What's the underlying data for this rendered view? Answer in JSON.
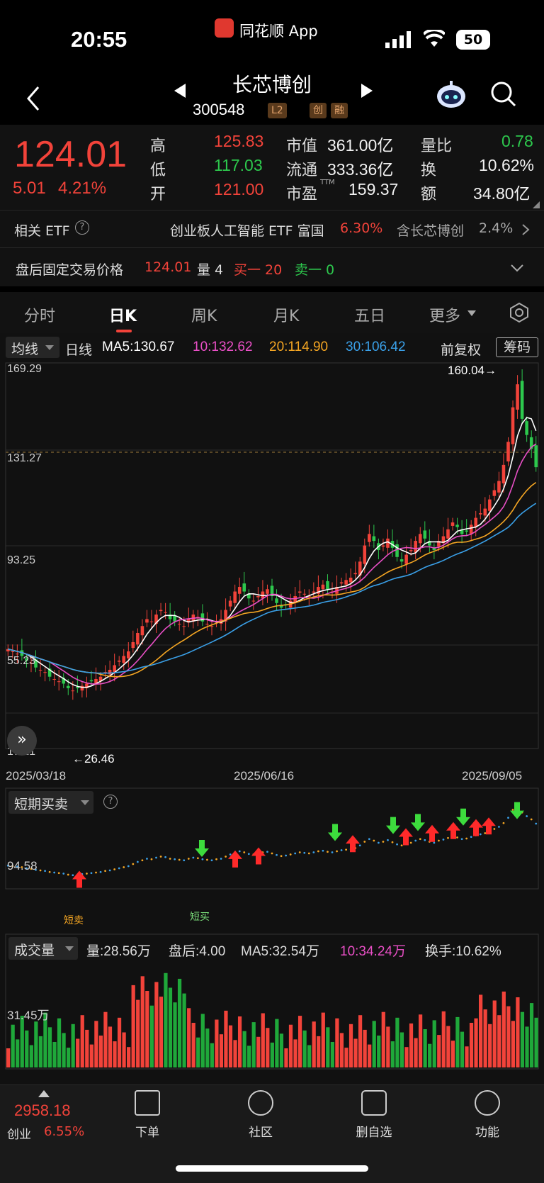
{
  "status_bar": {
    "time": "20:55",
    "app_name": "同花顺 App",
    "battery": "50"
  },
  "nav": {
    "stock_name": "长芯博创",
    "stock_code": "300548",
    "tags": [
      "L2",
      "创",
      "融"
    ]
  },
  "quote": {
    "price": "124.01",
    "change": "5.01",
    "change_pct": "4.21%",
    "high_label": "高",
    "high": "125.83",
    "low_label": "低",
    "low": "117.03",
    "open_label": "开",
    "open": "121.00",
    "mktcap_label": "市值",
    "mktcap": "361.00亿",
    "float_label": "流通",
    "float_cap": "333.36亿",
    "pe_label": "市盈",
    "pe_sup": "TTM",
    "pe": "159.37",
    "vol_ratio_label": "量比",
    "vol_ratio": "0.78",
    "turnover_label": "换",
    "turnover": "10.62%",
    "amount_label": "额",
    "amount": "34.80亿"
  },
  "etf": {
    "label": "相关 ETF",
    "name": "创业板人工智能 ETF 富国",
    "pct": "6.30%",
    "holding": "含长芯博创",
    "holding_pct": "2.4%"
  },
  "after_hours": {
    "label": "盘后固定交易价格",
    "price": "124.01",
    "vol_label": "量 4",
    "buy": "买一 20",
    "sell": "卖一 0"
  },
  "tabs": [
    "分时",
    "日K",
    "周K",
    "月K",
    "五日",
    "更多"
  ],
  "active_tab": 1,
  "ma_legend": {
    "type": "均线",
    "period": "日线",
    "ma5": "MA5:130.67",
    "ma10": "10:132.62",
    "ma20": "20:114.90",
    "ma30": "30:106.42",
    "adjust": "前复权",
    "chips": "筹码"
  },
  "price_axis": [
    "169.29",
    "131.27",
    "93.25",
    "55.23",
    "17.21"
  ],
  "annotations": {
    "max": "160.04→",
    "min": "←26.46"
  },
  "dates": [
    "2025/03/18",
    "2025/06/16",
    "2025/09/05"
  ],
  "indicator": {
    "name": "短期买卖",
    "level": "94.58",
    "signal_buy": "短买",
    "signal_sell": "短卖"
  },
  "volume_panel": {
    "name": "成交量",
    "vol": "量:28.56万",
    "after": "盘后:4.00",
    "ma5": "MA5:32.54万",
    "ma10": "10:34.24万",
    "turnover": "换手:10.62%",
    "level": "31.45万"
  },
  "bottom_bar": {
    "index_value": "2958.18",
    "index_name": "创业",
    "index_pct": "6.55%",
    "items": [
      "下单",
      "社区",
      "删自选",
      "功能"
    ]
  },
  "colors": {
    "up": "#f2433a",
    "down": "#2dc84d",
    "ma5": "#ffffff",
    "ma10": "#e94fc6",
    "ma20": "#f5a623",
    "ma30": "#3aa0e8"
  },
  "chart_data": {
    "type": "candlestick",
    "ylim": [
      17.21,
      169.29
    ],
    "closes": [
      45,
      44,
      43,
      42,
      40,
      39,
      37,
      36,
      35,
      33,
      32,
      31,
      30,
      28,
      27,
      28,
      29,
      30,
      31,
      32,
      33,
      35,
      36,
      38,
      40,
      42,
      44,
      48,
      52,
      55,
      58,
      57,
      60,
      62,
      61,
      58,
      57,
      56,
      55,
      58,
      60,
      59,
      57,
      56,
      55,
      57,
      58,
      62,
      66,
      70,
      72,
      70,
      67,
      66,
      68,
      70,
      71,
      68,
      65,
      63,
      64,
      66,
      68,
      70,
      69,
      68,
      70,
      72,
      73,
      71,
      70,
      72,
      74,
      75,
      76,
      78,
      83,
      90,
      95,
      92,
      88,
      90,
      93,
      89,
      85,
      83,
      86,
      88,
      92,
      95,
      93,
      90,
      88,
      92,
      94,
      97,
      100,
      98,
      95,
      96,
      99,
      102,
      104,
      106,
      110,
      114,
      118,
      125,
      135,
      150,
      160,
      145,
      138,
      132,
      124
    ]
  }
}
